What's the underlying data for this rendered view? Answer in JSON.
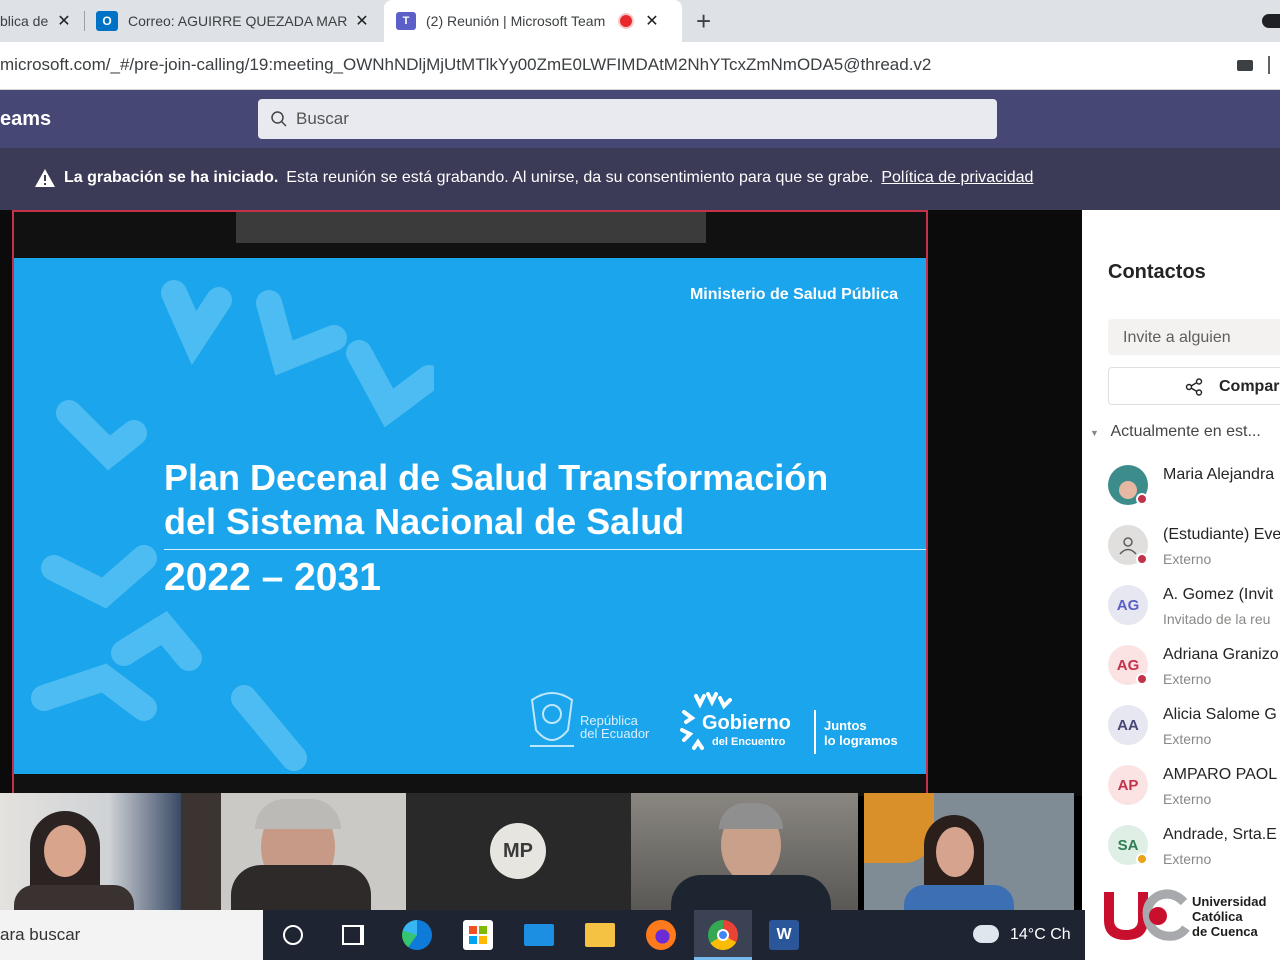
{
  "browser": {
    "tabs": [
      {
        "title": "blica de",
        "active": false
      },
      {
        "title": "Correo: AGUIRRE QUEZADA MAR",
        "active": false
      },
      {
        "title": "(2) Reunión | Microsoft Team",
        "active": true
      }
    ],
    "new_tab_label": "+",
    "close_glyph": "✕",
    "url": "microsoft.com/_#/pre-join-calling/19:meeting_OWNhNDljMjUtMTlkYy00ZmE0LWFIMDAtM2NhYTcxZmNmODA5@thread.v2"
  },
  "teams": {
    "app_title": "eams",
    "search_placeholder": "Buscar",
    "banner": {
      "bold": "La grabación se ha iniciado.",
      "text": "Esta reunión se está grabando. Al unirse, da su consentimiento para que se grabe.",
      "link": "Política de privacidad"
    }
  },
  "slide": {
    "ministry": "Ministerio de Salud Pública",
    "title_line1": "Plan Decenal de Salud Transformación",
    "title_line2": "del Sistema Nacional de Salud",
    "years": "2022 – 2031",
    "republica_line1": "República",
    "republica_line2": "del Ecuador",
    "gobierno": "Gobierno",
    "gobierno_sub": "del Encuentro",
    "juntos_line1": "Juntos",
    "juntos_line2": "lo logramos"
  },
  "contacts": {
    "title": "Contactos",
    "invite_placeholder": "Invite a alguien",
    "share_label": "Compar",
    "section_label": "Actualmente en est...",
    "people": [
      {
        "name": "Maria Alejandra",
        "role": "",
        "initials": "",
        "status": "#c4314b",
        "photo": true
      },
      {
        "name": "(Estudiante) Eve",
        "role": "Externo",
        "initials": "",
        "status": "#c4314b",
        "photo": false
      },
      {
        "name": "A. Gomez (Invit",
        "role": "Invitado de la reu",
        "initials": "AG",
        "status": "",
        "photo": false
      },
      {
        "name": "Adriana Granizo",
        "role": "Externo",
        "initials": "AG",
        "status": "#c4314b",
        "photo": false
      },
      {
        "name": "Alicia Salome G",
        "role": "Externo",
        "initials": "AA",
        "status": "",
        "photo": false
      },
      {
        "name": "AMPARO PAOL",
        "role": "Externo",
        "initials": "AP",
        "status": "",
        "photo": false
      },
      {
        "name": "Andrade, Srta.E",
        "role": "Externo",
        "initials": "SA",
        "status": "#e8a317",
        "photo": false
      }
    ]
  },
  "video_tiles": [
    {
      "initials": ""
    },
    {
      "initials": ""
    },
    {
      "initials": "MP"
    },
    {
      "initials": ""
    },
    {
      "initials": ""
    }
  ],
  "taskbar": {
    "search_text": "ara buscar",
    "weather": "14°C Ch"
  },
  "watermark": {
    "text": "Universidad\nCatólica\nde Cuenca"
  }
}
